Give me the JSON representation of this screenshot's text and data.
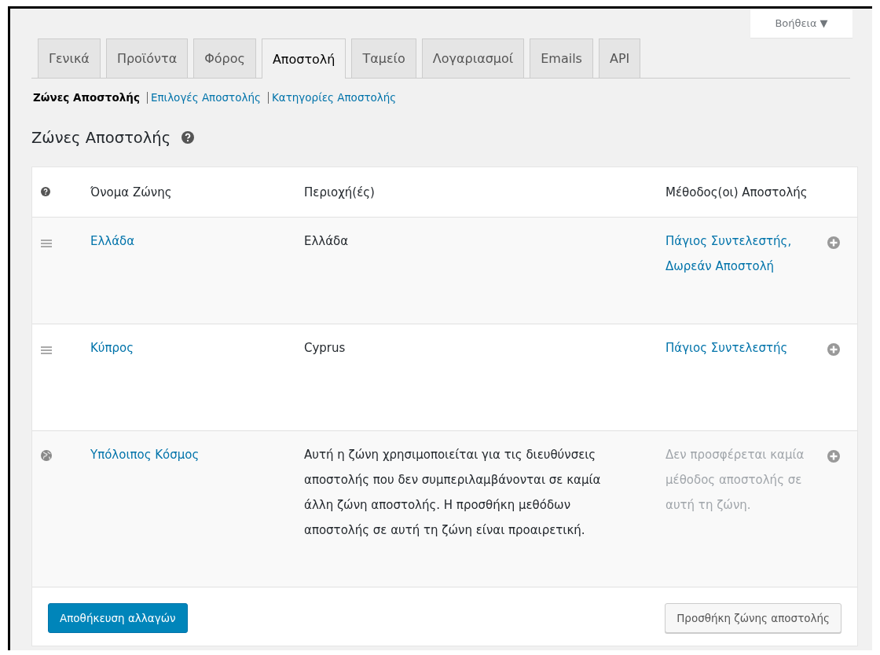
{
  "help_button": "Βοήθεια ▼",
  "tabs": [
    {
      "label": "Γενικά",
      "selected": false
    },
    {
      "label": "Προϊόντα",
      "selected": false
    },
    {
      "label": "Φόρος",
      "selected": false
    },
    {
      "label": "Αποστολή",
      "selected": true
    },
    {
      "label": "Ταμείο",
      "selected": false
    },
    {
      "label": "Λογαριασμοί",
      "selected": false
    },
    {
      "label": "Emails",
      "selected": false
    },
    {
      "label": "API",
      "selected": false
    }
  ],
  "subnav": [
    {
      "label": "Ζώνες Αποστολής",
      "selected": true
    },
    {
      "label": "Επιλογές Αποστολής",
      "selected": false
    },
    {
      "label": "Κατηγορίες Αποστολής",
      "selected": false
    }
  ],
  "heading": "Ζώνες Αποστολής",
  "table": {
    "columns": [
      "Όνομα Ζώνης",
      "Περιοχή(ές)",
      "Μέθοδος(οι) Αποστολής"
    ],
    "rows": [
      {
        "kind": "zone",
        "name": "Ελλάδα",
        "region": "Ελλάδα",
        "methods": [
          "Πάγιος Συντελεστής,",
          "Δωρεάν Αποστολή"
        ]
      },
      {
        "kind": "zone",
        "name": "Κύπρος",
        "region": "Cyprus",
        "methods": [
          "Πάγιος Συντελεστής"
        ]
      },
      {
        "kind": "rest",
        "name": "Υπόλοιπος Κόσμος",
        "region": "Αυτή η ζώνη χρησιμοποιείται για τις διευθύνσεις αποστολής που δεν συμπεριλαμβάνονται σε καμία άλλη ζώνη αποστολής. Η προσθήκη μεθόδων αποστολής σε αυτή τη ζώνη είναι προαιρετική.",
        "no_methods": "Δεν προσφέρεται καμία μέθοδος αποστολής σε αυτή τη ζώνη."
      }
    ]
  },
  "save_button": "Αποθήκευση αλλαγών",
  "add_zone_button": "Προσθήκη ζώνης αποστολής"
}
